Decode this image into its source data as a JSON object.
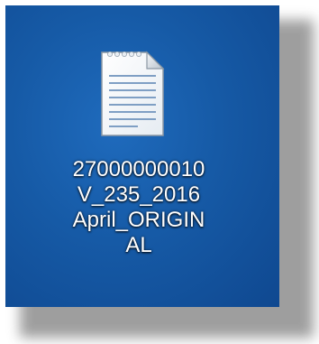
{
  "desktop": {
    "background_color": "#165aa6",
    "icon": {
      "type": "text-document-icon",
      "label_lines": [
        "27000000010",
        "V_235_2016",
        "April_ORIGIN",
        "AL"
      ]
    }
  }
}
